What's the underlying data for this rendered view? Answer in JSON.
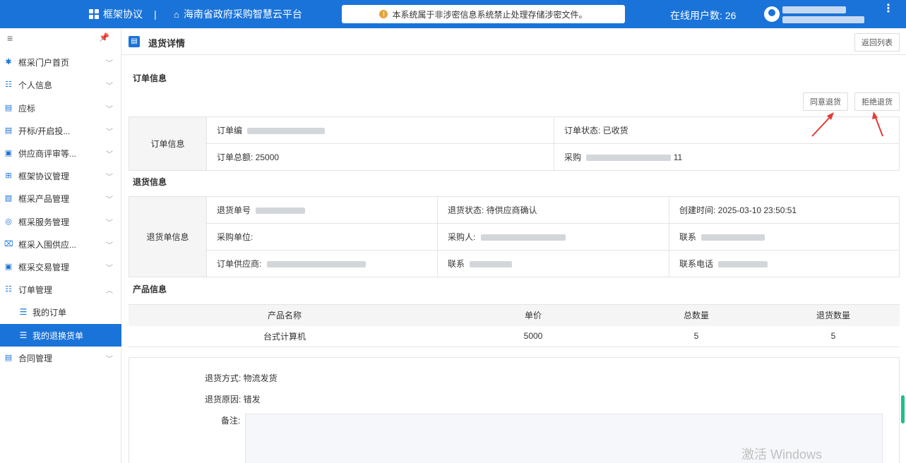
{
  "header": {
    "system_name": "框架协议",
    "separator": "|",
    "platform_name": "海南省政府采购智慧云平台",
    "notice": "本系统属于非涉密信息系统禁止处理存储涉密文件。",
    "online_users": "在线用户数: 26",
    "more_icon": "⋮"
  },
  "sidebar": {
    "items": [
      {
        "label": "框采门户首页",
        "icon": "grid-icon"
      },
      {
        "label": "个人信息",
        "icon": "person-card-icon"
      },
      {
        "label": "应标",
        "icon": "bid-icon"
      },
      {
        "label": "开标/开启投...",
        "icon": "open-bid-icon"
      },
      {
        "label": "供应商评审等...",
        "icon": "monitor-icon"
      },
      {
        "label": "框架协议管理",
        "icon": "agreement-icon"
      },
      {
        "label": "框采产品管理",
        "icon": "product-icon"
      },
      {
        "label": "框采服务管理",
        "icon": "service-icon"
      },
      {
        "label": "框采入围供应...",
        "icon": "supplier-icon"
      },
      {
        "label": "框采交易管理",
        "icon": "trade-icon"
      },
      {
        "label": "订单管理",
        "icon": "order-icon"
      }
    ],
    "sub_items": [
      {
        "label": "我的订单"
      },
      {
        "label": "我的退换货单"
      }
    ],
    "last_item": {
      "label": "合同管理"
    }
  },
  "page": {
    "title": "退货详情",
    "back_button": "返回列表",
    "agree_button": "同意退货",
    "reject_button": "拒绝退货"
  },
  "order_section": {
    "title": "订单信息",
    "label": "订单信息",
    "order_no": "订单编",
    "order_status": "订单状态: 已收货",
    "order_total": "订单总额: 25000",
    "purchase": "采购",
    "purchase_suffix": "11"
  },
  "return_section": {
    "title": "退货信息",
    "label": "退货单信息",
    "return_no": "退货单号",
    "return_status": "退货状态: 待供应商确认",
    "created_time": "创建时间: 2025-03-10 23:50:51",
    "buyer_unit": "采购单位:",
    "buyer": "采购人:",
    "contact": "联系",
    "order_supplier": "订单供应商:",
    "contact2": "联系",
    "contact_phone": "联系电话"
  },
  "product_section": {
    "title": "产品信息",
    "columns": [
      "产品名称",
      "单价",
      "总数量",
      "退货数量"
    ],
    "rows": [
      [
        "台式计算机",
        "5000",
        "5",
        "5"
      ]
    ]
  },
  "extra": {
    "return_method": "退货方式: 物流发货",
    "return_reason": "退货原因: 错发",
    "remark_label": "备注:"
  },
  "watermark": "激活 Windows",
  "colors": {
    "primary": "#1a73d9",
    "arrow": "#e53935"
  }
}
